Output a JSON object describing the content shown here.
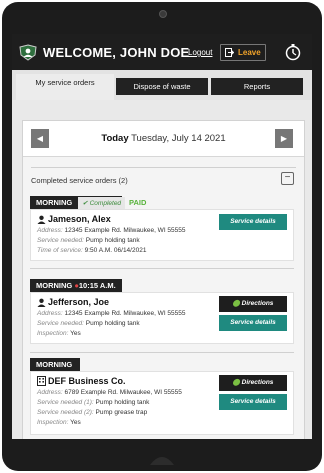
{
  "header": {
    "welcome": "WELCOME, JOHN DOE",
    "logout": "Logout",
    "leave": "Leave"
  },
  "nav": {
    "tabs": [
      "My service orders",
      "Dispose of waste",
      "Reports"
    ],
    "active": 0
  },
  "date": {
    "today": "Today",
    "date_text": "Tuesday, July 14 2021",
    "prev_icon": "chevron-left-icon",
    "next_icon": "chevron-right-icon"
  },
  "completed": {
    "label": "Completed service orders (2)",
    "toggle": "−"
  },
  "orders": [
    {
      "slot": "MORNING",
      "badge": "Completed",
      "paid": "PAID",
      "name": "Jameson, Alex",
      "rows": [
        {
          "label": "Address:",
          "value": "12345 Example Rd. Milwaukee, WI 55555"
        },
        {
          "label": "Service needed:",
          "value": "Pump holding tank"
        },
        {
          "label": "Time of service:",
          "value": "9:50 A.M. 06/14/2021"
        }
      ],
      "details": "Service details"
    },
    {
      "slot": "MORNING",
      "slot_time": "10:15 A.M.",
      "name": "Jefferson, Joe",
      "rows": [
        {
          "label": "Address:",
          "value": "12345 Example Rd. Milwaukee, WI 55555"
        },
        {
          "label": "Service needed:",
          "value": "Pump holding tank"
        },
        {
          "label": "Inspection:",
          "value": "Yes"
        }
      ],
      "directions": "Directions",
      "details": "Service details"
    },
    {
      "slot": "MORNING",
      "name": "DEF Business Co.",
      "rows": [
        {
          "label": "Address:",
          "value": "6789 Example Rd. Milwaukee, WI 55555"
        },
        {
          "label": "Service needed (1):",
          "value": "Pump holding tank"
        },
        {
          "label": "Service needed (2):",
          "value": "Pump grease trap"
        },
        {
          "label": "Inspection:",
          "value": "Yes"
        }
      ],
      "directions": "Directions",
      "details": "Service details"
    }
  ],
  "colors": {
    "accent": "#1f8a80",
    "leave": "#f0a32a",
    "paid": "#58b33b",
    "dark": "#1e1e1e"
  }
}
